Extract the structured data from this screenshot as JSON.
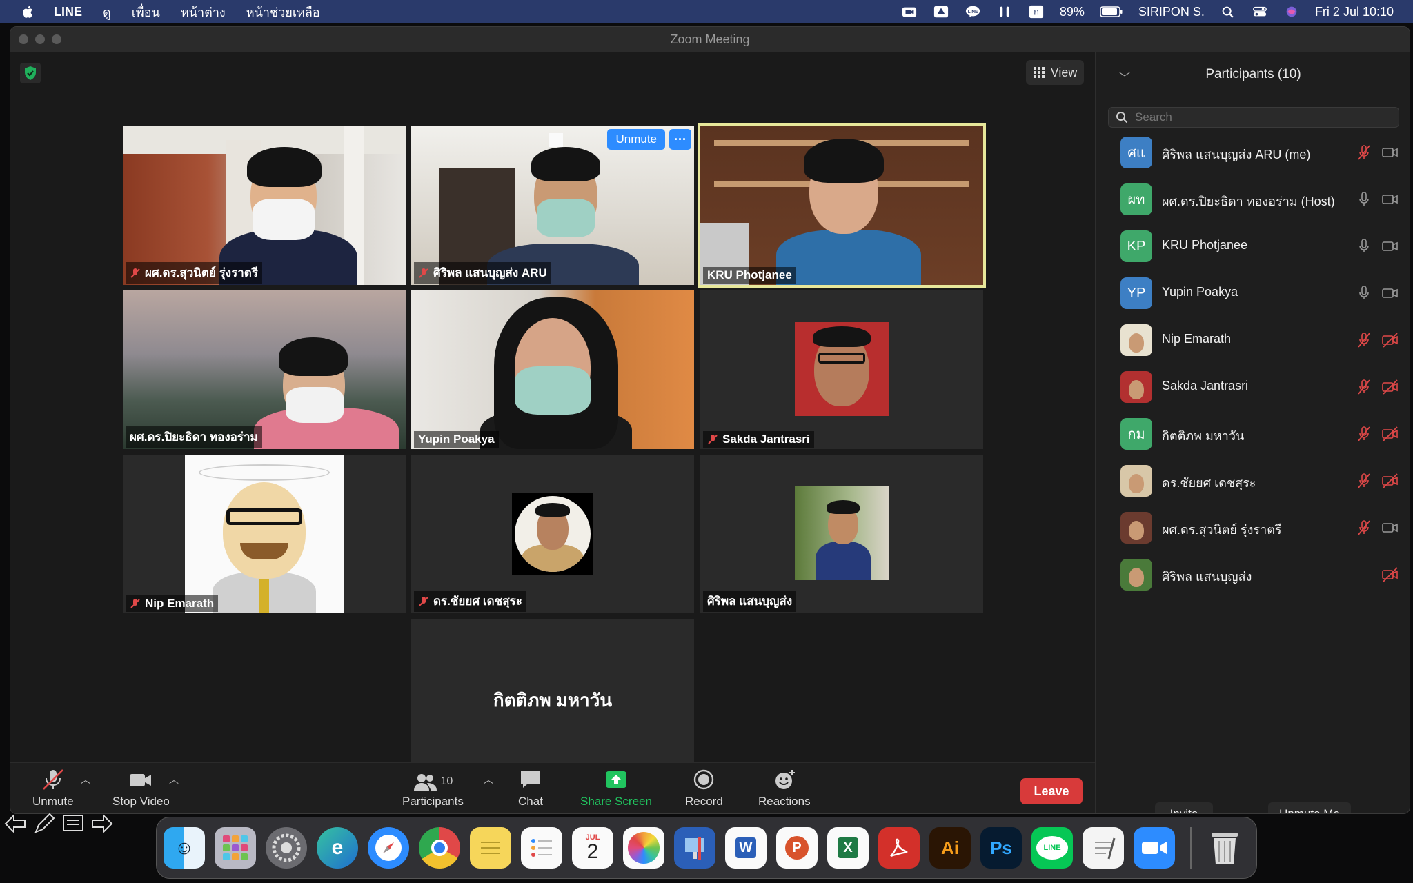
{
  "menubar": {
    "app_name": "LINE",
    "menus": [
      "ดู",
      "เพื่อน",
      "หน้าต่าง",
      "หน้าช่วยเหลือ"
    ],
    "battery": "89%",
    "user": "SIRIPON S.",
    "datetime": "Fri 2 Jul  10:10"
  },
  "window": {
    "title": "Zoom Meeting"
  },
  "stage": {
    "view_label": "View",
    "unmute_label": "Unmute",
    "more_label": "···",
    "tiles": [
      {
        "name": "ผศ.ดร.สุวนิตย์ รุ่งราตรี",
        "muted": true
      },
      {
        "name": "ศิริพล แสนบุญส่ง ARU",
        "muted": true
      },
      {
        "name": "KRU Photjanee",
        "muted": false
      },
      {
        "name": "ผศ.ดร.ปิยะธิดา ทองอร่าม",
        "muted": false
      },
      {
        "name": "Yupin Poakya",
        "muted": false
      },
      {
        "name": "Sakda Jantrasri",
        "muted": true
      },
      {
        "name": "Nip Emarath",
        "muted": true
      },
      {
        "name": "ดร.ชัยยศ เดชสุระ",
        "muted": true
      },
      {
        "name": "ศิริพล แสนบุญส่ง",
        "muted": false
      },
      {
        "name": "กิตติภพ มหาวัน",
        "muted": true
      }
    ]
  },
  "toolbar": {
    "unmute": "Unmute",
    "stop_video": "Stop Video",
    "participants": "Participants",
    "participants_count": "10",
    "chat": "Chat",
    "share_screen": "Share Screen",
    "record": "Record",
    "reactions": "Reactions",
    "leave": "Leave"
  },
  "panel": {
    "title": "Participants (10)",
    "search_placeholder": "Search",
    "participants": [
      {
        "initials": "ศแ",
        "name": "ศิริพล แสนบุญส่ง ARU (me)",
        "color": "#3d7fc4",
        "mic": "muted",
        "cam": "on"
      },
      {
        "initials": "ผท",
        "name": "ผศ.ดร.ปิยะธิดา ทองอร่าม (Host)",
        "color": "#3fa86a",
        "mic": "on",
        "cam": "on"
      },
      {
        "initials": "KP",
        "name": "KRU Photjanee",
        "color": "#3fa86a",
        "mic": "on",
        "cam": "on"
      },
      {
        "initials": "YP",
        "name": "Yupin Poakya",
        "color": "#3d7fc4",
        "mic": "on",
        "cam": "on"
      },
      {
        "initials": "",
        "name": "Nip Emarath",
        "color": "#e8e2d0",
        "mic": "muted",
        "cam": "off"
      },
      {
        "initials": "",
        "name": "Sakda Jantrasri",
        "color": "#b23030",
        "mic": "muted",
        "cam": "off"
      },
      {
        "initials": "กม",
        "name": "กิตติภพ มหาวัน",
        "color": "#3fa86a",
        "mic": "muted",
        "cam": "off"
      },
      {
        "initials": "",
        "name": "ดร.ชัยยศ เดชสุระ",
        "color": "#d8c7a8",
        "mic": "muted",
        "cam": "off"
      },
      {
        "initials": "",
        "name": "ผศ.ดร.สุวนิตย์ รุ่งราตรี",
        "color": "#6b3b2f",
        "mic": "muted",
        "cam": "on"
      },
      {
        "initials": "",
        "name": "ศิริพล แสนบุญส่ง",
        "color": "#4a7a3a",
        "mic": "none",
        "cam": "off"
      }
    ],
    "invite": "Invite",
    "unmute_me": "Unmute Me"
  },
  "dock": {
    "calendar_month": "JUL",
    "calendar_day": "2",
    "illustrator": "Ai",
    "photoshop": "Ps",
    "line": "LINE"
  },
  "colors": {
    "accent": "#2d8cff",
    "leave": "#d83a3a",
    "share": "#21c45f",
    "muted_red": "#e04848",
    "active_speaker": "#e7e79a"
  }
}
